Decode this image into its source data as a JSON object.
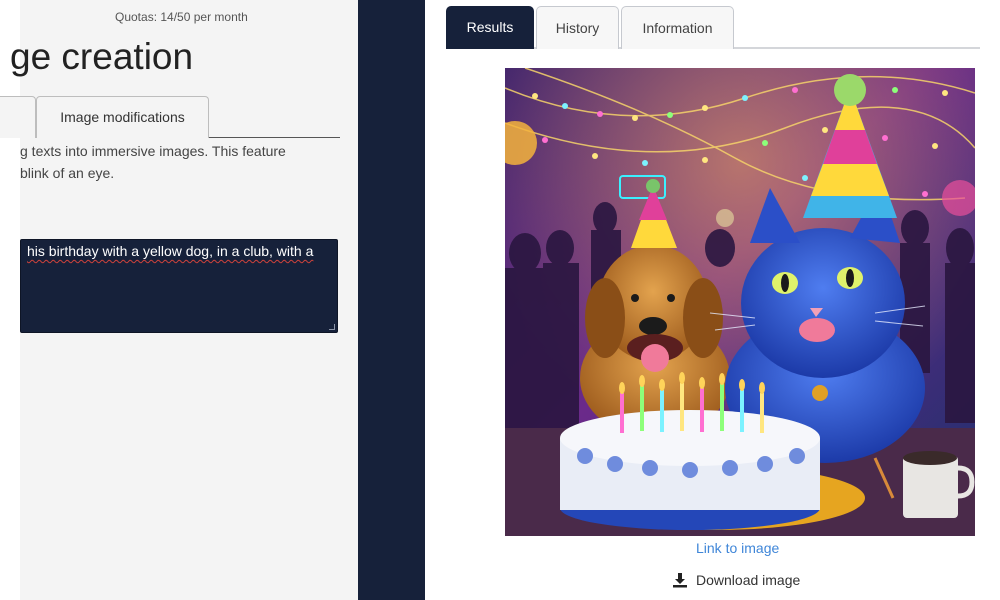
{
  "left": {
    "quota": "Quotas: 14/50 per month",
    "title": "ge creation",
    "tabs": [
      {
        "label": "Image modifications"
      }
    ],
    "description": "g texts into immersive images. This feature\n blink of an eye.",
    "prompt_text": " his birthday with a yellow dog, in a club, with a"
  },
  "tabs": [
    {
      "label": "Results",
      "active": true
    },
    {
      "label": "History",
      "active": false
    },
    {
      "label": "Information",
      "active": false
    }
  ],
  "result": {
    "image_icon": "generated-image",
    "link_label": "Link to image",
    "download_label": "Download image",
    "download_icon": "download-icon"
  },
  "colors": {
    "navy": "#16213a",
    "link": "#3f86d8",
    "panel_bg": "#f4f4f4"
  }
}
